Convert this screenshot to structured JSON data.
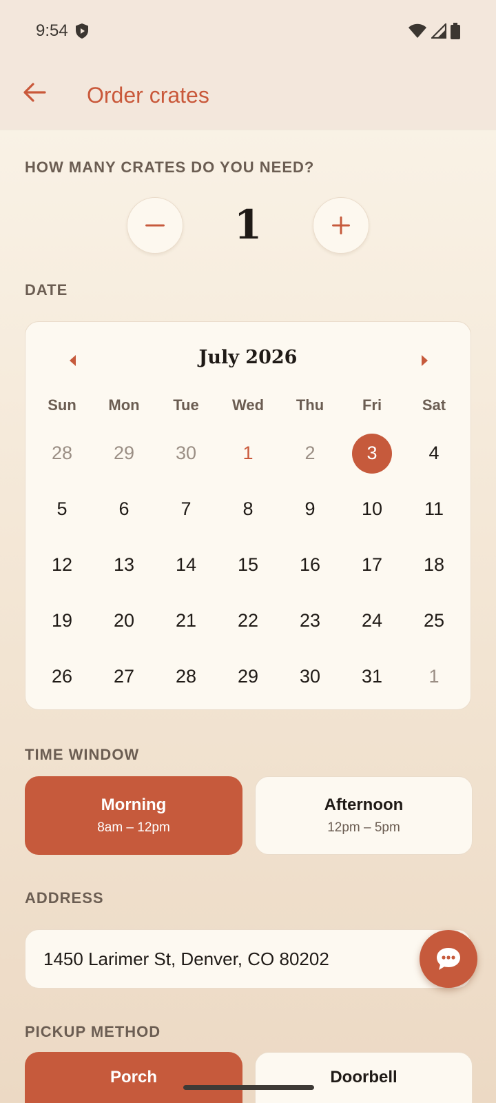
{
  "status": {
    "time": "9:54"
  },
  "header": {
    "title": "Order crates"
  },
  "quantity": {
    "label": "HOW MANY CRATES DO YOU NEED?",
    "value": "1",
    "minus": "−",
    "plus": "+"
  },
  "date": {
    "label": "DATE",
    "month": "July 2026",
    "weekdays": [
      "Sun",
      "Mon",
      "Tue",
      "Wed",
      "Thu",
      "Fri",
      "Sat"
    ],
    "days": [
      {
        "d": "28",
        "s": "muted"
      },
      {
        "d": "29",
        "s": "muted"
      },
      {
        "d": "30",
        "s": "muted"
      },
      {
        "d": "1",
        "s": "accent"
      },
      {
        "d": "2",
        "s": "muted"
      },
      {
        "d": "3",
        "s": "selected"
      },
      {
        "d": "4",
        "s": ""
      },
      {
        "d": "5",
        "s": ""
      },
      {
        "d": "6",
        "s": ""
      },
      {
        "d": "7",
        "s": ""
      },
      {
        "d": "8",
        "s": ""
      },
      {
        "d": "9",
        "s": ""
      },
      {
        "d": "10",
        "s": ""
      },
      {
        "d": "11",
        "s": ""
      },
      {
        "d": "12",
        "s": ""
      },
      {
        "d": "13",
        "s": ""
      },
      {
        "d": "14",
        "s": ""
      },
      {
        "d": "15",
        "s": ""
      },
      {
        "d": "16",
        "s": ""
      },
      {
        "d": "17",
        "s": ""
      },
      {
        "d": "18",
        "s": ""
      },
      {
        "d": "19",
        "s": ""
      },
      {
        "d": "20",
        "s": ""
      },
      {
        "d": "21",
        "s": ""
      },
      {
        "d": "22",
        "s": ""
      },
      {
        "d": "23",
        "s": ""
      },
      {
        "d": "24",
        "s": ""
      },
      {
        "d": "25",
        "s": ""
      },
      {
        "d": "26",
        "s": ""
      },
      {
        "d": "27",
        "s": ""
      },
      {
        "d": "28",
        "s": ""
      },
      {
        "d": "29",
        "s": ""
      },
      {
        "d": "30",
        "s": ""
      },
      {
        "d": "31",
        "s": ""
      },
      {
        "d": "1",
        "s": "muted"
      }
    ]
  },
  "time_window": {
    "label": "TIME WINDOW",
    "morning": {
      "title": "Morning",
      "sub": "8am – 12pm"
    },
    "afternoon": {
      "title": "Afternoon",
      "sub": "12pm – 5pm"
    },
    "selected": "Morning"
  },
  "address": {
    "label": "ADDRESS",
    "value": "1450 Larimer St, Denver, CO 80202"
  },
  "pickup": {
    "label": "PICKUP METHOD",
    "porch": "Porch",
    "doorbell": "Doorbell",
    "selected": "Porch"
  },
  "colors": {
    "accent": "#c65a3c",
    "title": "#c9583a",
    "background": "#f6ecdf"
  },
  "icons": {
    "back": "arrow-left-icon",
    "chat": "chat-bubble-icon"
  }
}
